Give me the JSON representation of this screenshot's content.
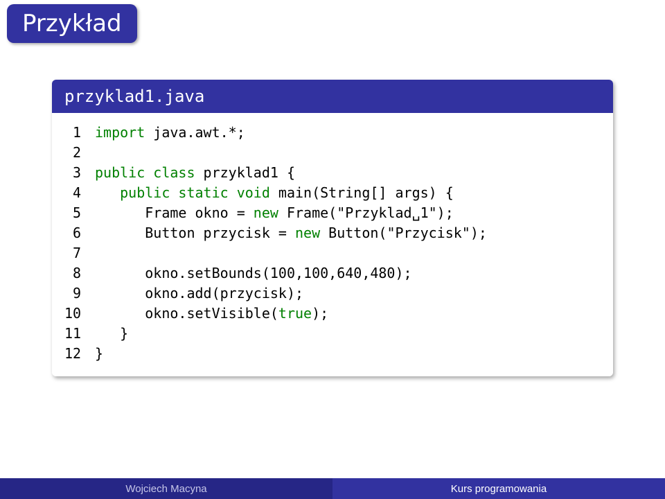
{
  "slide": {
    "title": "Przykład"
  },
  "block": {
    "title": "przyklad1.java"
  },
  "code": {
    "lines": [
      {
        "n": "1",
        "seg": [
          {
            "c": "kw",
            "t": "import"
          },
          {
            "c": "plain",
            "t": " java.awt.*;"
          }
        ]
      },
      {
        "n": "2",
        "seg": []
      },
      {
        "n": "3",
        "seg": [
          {
            "c": "kw",
            "t": "public class"
          },
          {
            "c": "plain",
            "t": " przyklad1 {"
          }
        ]
      },
      {
        "n": "4",
        "seg": [
          {
            "c": "plain",
            "t": "   "
          },
          {
            "c": "kw",
            "t": "public static void"
          },
          {
            "c": "plain",
            "t": " main(String[] args) {"
          }
        ]
      },
      {
        "n": "5",
        "seg": [
          {
            "c": "plain",
            "t": "      Frame okno = "
          },
          {
            "c": "kw",
            "t": "new"
          },
          {
            "c": "plain",
            "t": " Frame(\"Przyklad␣1\");"
          }
        ]
      },
      {
        "n": "6",
        "seg": [
          {
            "c": "plain",
            "t": "      Button przycisk = "
          },
          {
            "c": "kw",
            "t": "new"
          },
          {
            "c": "plain",
            "t": " Button(\"Przycisk\");"
          }
        ]
      },
      {
        "n": "7",
        "seg": []
      },
      {
        "n": "8",
        "seg": [
          {
            "c": "plain",
            "t": "      okno.setBounds(100,100,640,480);"
          }
        ]
      },
      {
        "n": "9",
        "seg": [
          {
            "c": "plain",
            "t": "      okno.add(przycisk);"
          }
        ]
      },
      {
        "n": "10",
        "seg": [
          {
            "c": "plain",
            "t": "      okno.setVisible("
          },
          {
            "c": "kw",
            "t": "true"
          },
          {
            "c": "plain",
            "t": ");"
          }
        ]
      },
      {
        "n": "11",
        "seg": [
          {
            "c": "plain",
            "t": "   }"
          }
        ]
      },
      {
        "n": "12",
        "seg": [
          {
            "c": "plain",
            "t": "}"
          }
        ]
      }
    ]
  },
  "footer": {
    "author": "Wojciech Macyna",
    "course": "Kurs programowania"
  }
}
